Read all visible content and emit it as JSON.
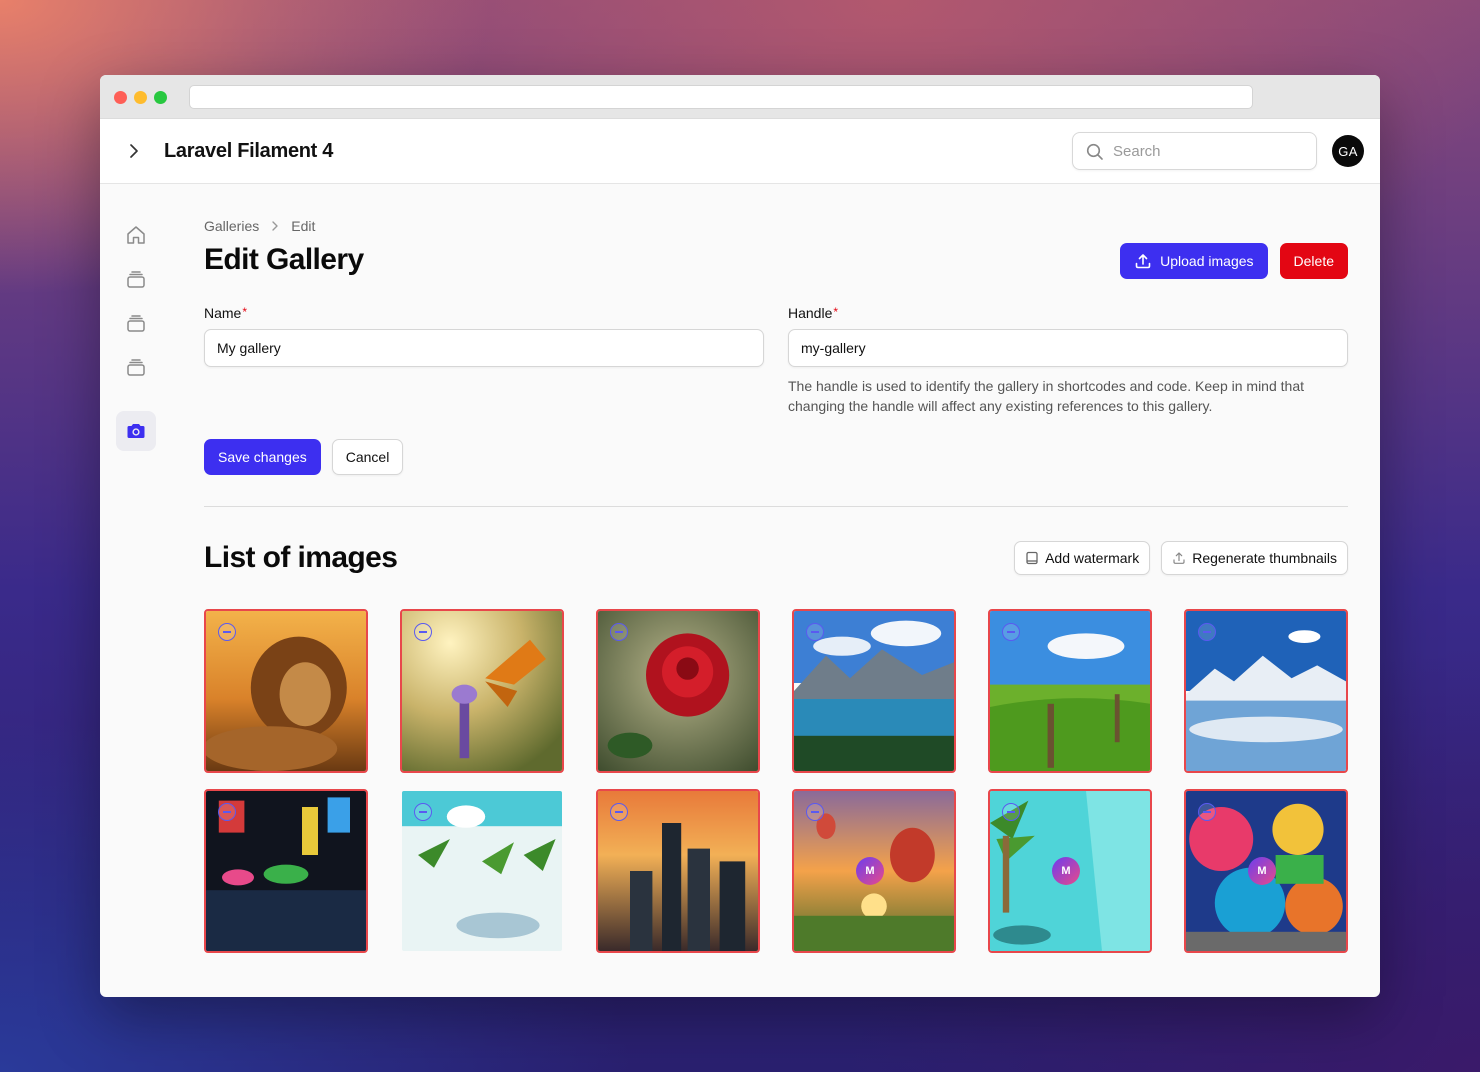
{
  "app": {
    "title": "Laravel Filament 4"
  },
  "search": {
    "placeholder": "Search"
  },
  "user": {
    "initials": "GA"
  },
  "breadcrumb": {
    "parent": "Galleries",
    "current": "Edit"
  },
  "page": {
    "title": "Edit Gallery"
  },
  "actions": {
    "upload_label": "Upload images",
    "delete_label": "Delete"
  },
  "form": {
    "name_label": "Name",
    "name_value": "My gallery",
    "handle_label": "Handle",
    "handle_value": "my-gallery",
    "handle_hint": "The handle is used to identify the gallery in shortcodes and code. Keep in mind that changing the handle will affect any existing references to this gallery.",
    "required_mark": "*",
    "save_label": "Save changes",
    "cancel_label": "Cancel"
  },
  "images_section": {
    "title": "List of images",
    "watermark_label": "Add watermark",
    "regenerate_label": "Regenerate thumbnails"
  },
  "images": [
    {
      "subject": "lion",
      "selected": true
    },
    {
      "subject": "butterfly",
      "selected": true
    },
    {
      "subject": "rose",
      "selected": true
    },
    {
      "subject": "mountain-lake",
      "selected": true
    },
    {
      "subject": "green-field",
      "selected": true
    },
    {
      "subject": "snowy-mountains",
      "selected": true
    },
    {
      "subject": "city-night-rain",
      "selected": true
    },
    {
      "subject": "palm-trees-beach",
      "selected": false
    },
    {
      "subject": "city-sunset",
      "selected": true
    },
    {
      "subject": "hot-air-balloons",
      "selected": true,
      "watermark": "M"
    },
    {
      "subject": "palm-beach-water",
      "selected": true,
      "watermark": "M"
    },
    {
      "subject": "abstract-mural",
      "selected": true,
      "watermark": "M"
    }
  ],
  "colors": {
    "primary": "#3d2ff0",
    "danger": "#e30613",
    "selected_border": "#e8474b"
  }
}
